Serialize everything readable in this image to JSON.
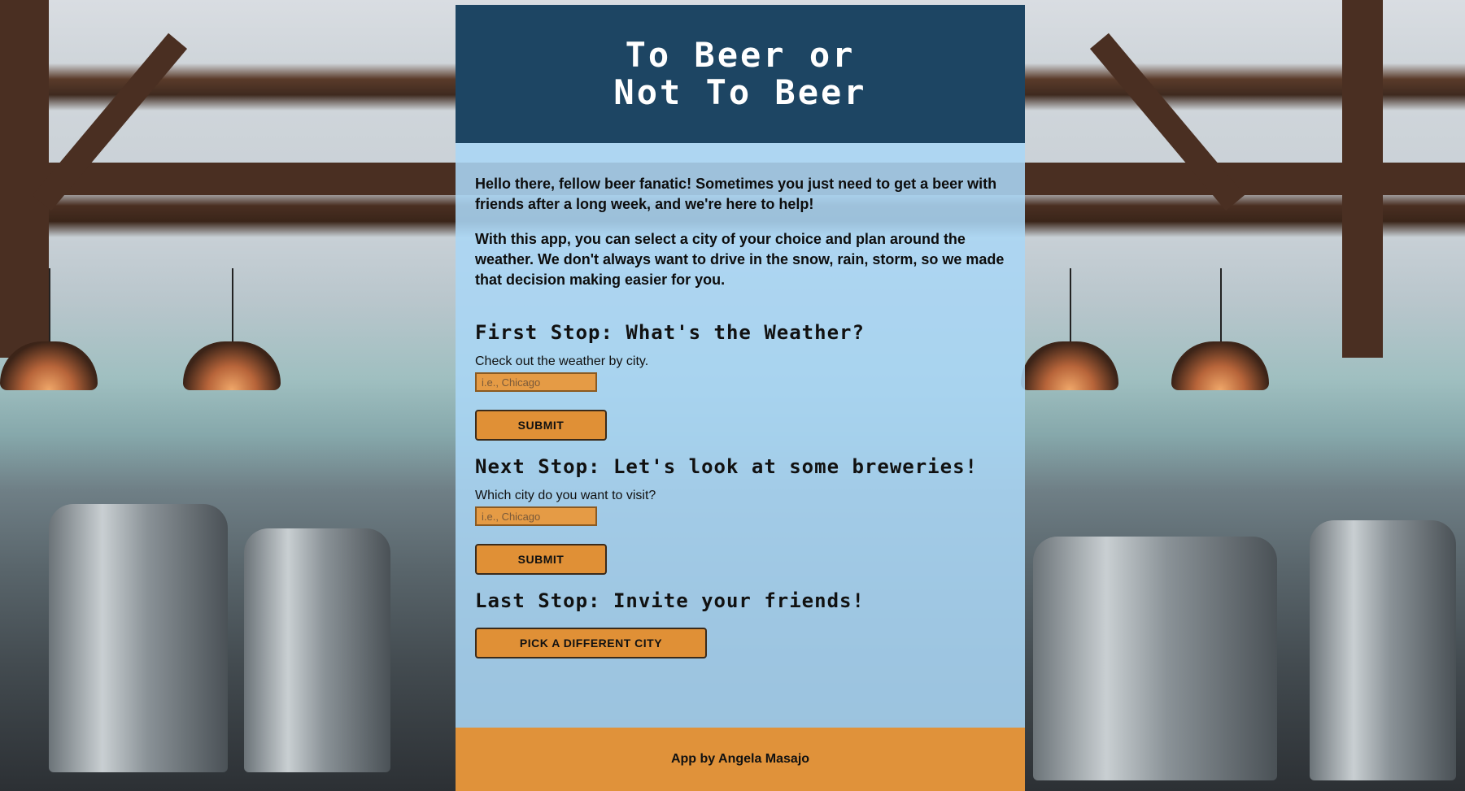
{
  "header": {
    "title": "To Beer or\nNot To Beer"
  },
  "intro": {
    "paragraph_1": "Hello there, fellow beer fanatic! Sometimes you just need to get a beer with friends after a long week, and we're here to help!",
    "paragraph_2": "With this app, you can select a city of your choice and plan around the weather. We don't always want to drive in the snow, rain, storm, so we made that decision making easier for you."
  },
  "weather": {
    "heading": "First Stop: What's the Weather?",
    "label": "Check out the weather by city.",
    "placeholder": "i.e., Chicago",
    "submit_label": "SUBMIT"
  },
  "breweries": {
    "heading": "Next Stop: Let's look at some breweries!",
    "label": "Which city do you want to visit?",
    "placeholder": "i.e., Chicago",
    "submit_label": "SUBMIT"
  },
  "invite": {
    "heading": "Last Stop: Invite your friends!",
    "button_label": "PICK A DIFFERENT CITY"
  },
  "footer": {
    "credit": "App by Angela Masajo"
  },
  "colors": {
    "header_bg": "#1d4563",
    "panel_bg": "#aad6f5",
    "accent_orange": "#e09036"
  }
}
